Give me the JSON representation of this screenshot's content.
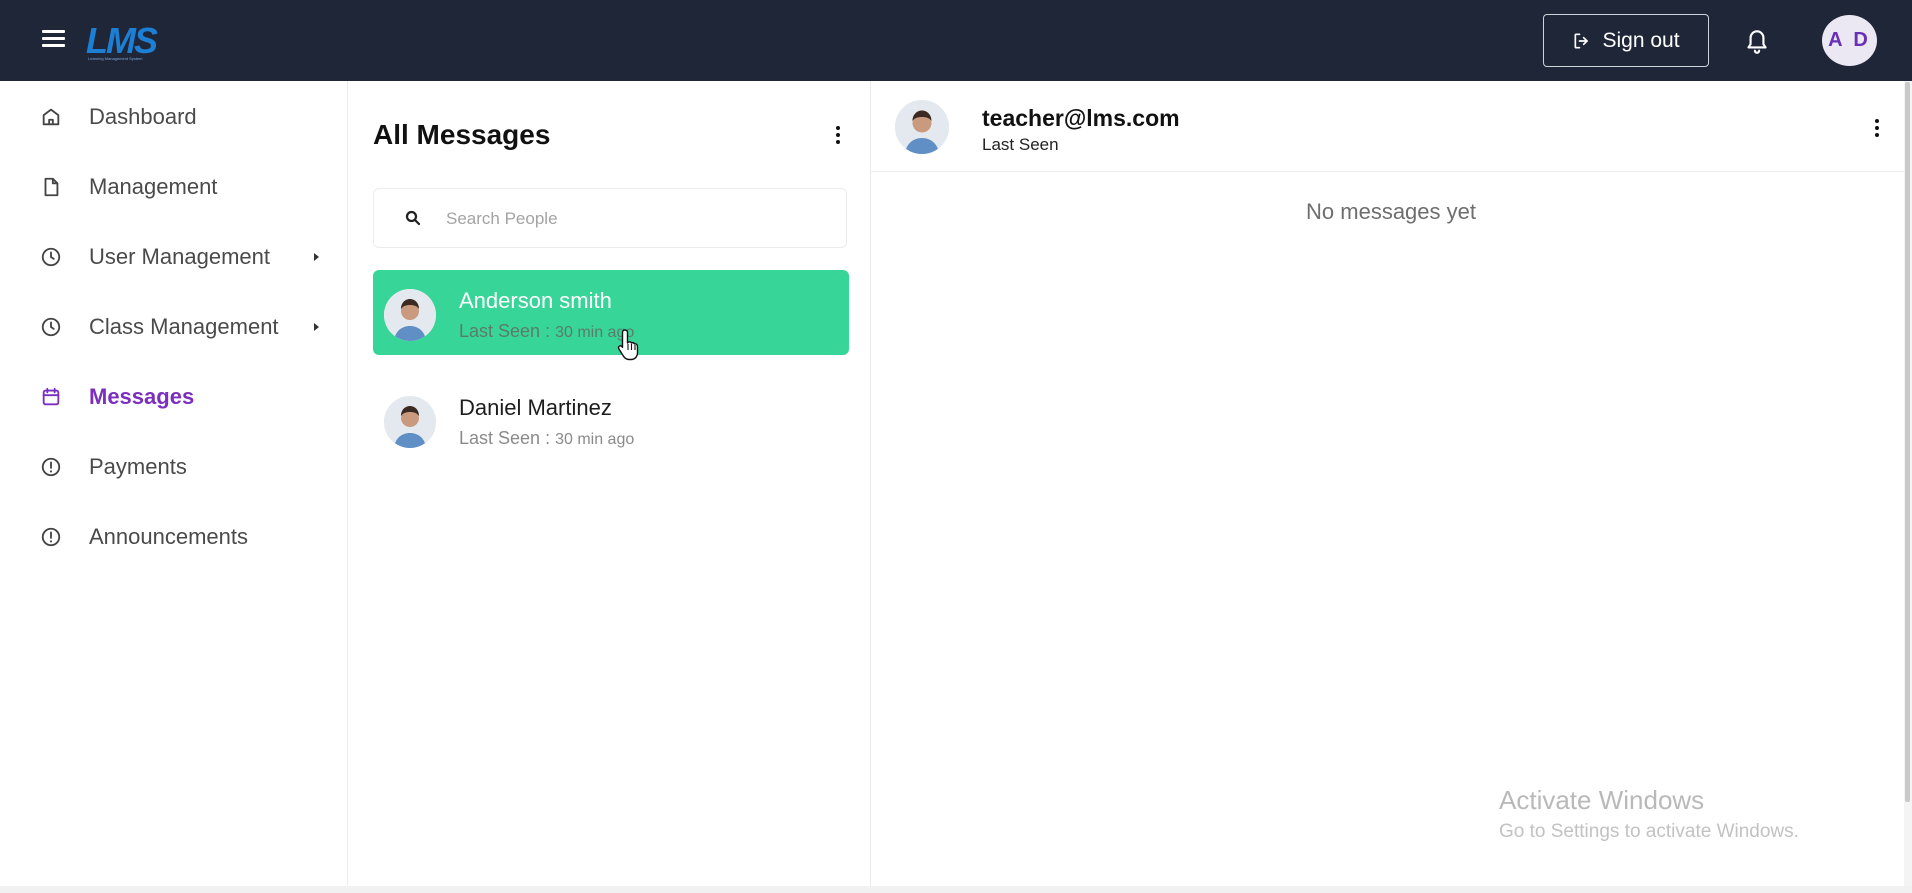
{
  "header": {
    "logo_text": "LMS",
    "logo_tagline": "Learning Management System",
    "signout_label": "Sign out",
    "avatar_initials": "A D",
    "icons": {
      "menu": "hamburger-icon",
      "signout": "logout-icon",
      "notifications": "bell-icon"
    }
  },
  "sidebar": {
    "items": [
      {
        "label": "Dashboard",
        "icon": "home-icon",
        "active": false,
        "submenu": false
      },
      {
        "label": "Management",
        "icon": "document-icon",
        "active": false,
        "submenu": false
      },
      {
        "label": "User Management",
        "icon": "clock-icon",
        "active": false,
        "submenu": true
      },
      {
        "label": "Class Management",
        "icon": "clock-icon",
        "active": false,
        "submenu": true
      },
      {
        "label": "Messages",
        "icon": "calendar-icon",
        "active": true,
        "submenu": false
      },
      {
        "label": "Payments",
        "icon": "alert-circle-icon",
        "active": false,
        "submenu": false
      },
      {
        "label": "Announcements",
        "icon": "alert-circle-icon",
        "active": false,
        "submenu": false
      }
    ],
    "active_color": "#7b2fbe"
  },
  "messages_list": {
    "title": "All Messages",
    "search": {
      "placeholder": "Search People",
      "value": ""
    },
    "contacts": [
      {
        "name": "Anderson smith",
        "seen_prefix": "Last Seen : ",
        "seen_ago": "30 min ago",
        "selected": true
      },
      {
        "name": "Daniel Martinez",
        "seen_prefix": "Last Seen : ",
        "seen_ago": "30 min ago",
        "selected": false
      }
    ],
    "selected_color": "#38d598"
  },
  "chat": {
    "email": "teacher@lms.com",
    "status": "Last Seen",
    "empty_text": "No messages yet"
  },
  "overlay": {
    "watermark_title": "Activate Windows",
    "watermark_subtitle": "Go to Settings to activate Windows."
  },
  "colors": {
    "topbar": "#1f2638",
    "accent_purple": "#7b2fbe",
    "accent_green": "#38d598"
  }
}
